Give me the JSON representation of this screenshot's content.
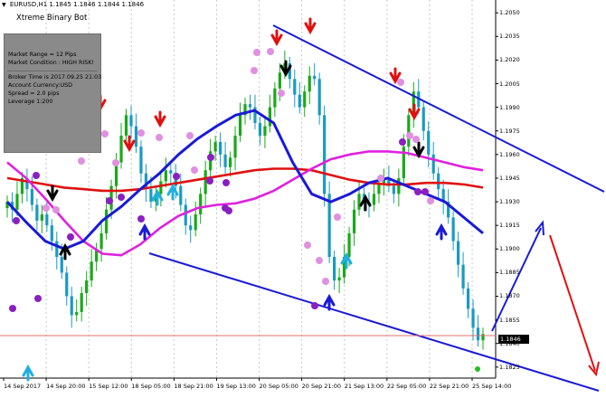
{
  "window": {
    "symbol_line": "EURUSD,H1  1.1845 1.1846 1.1844 1.1846",
    "indicator_title": "Xtreme Binary Bot"
  },
  "info_panel": {
    "market_range": "Market Range = 12 Pips",
    "market_condition": "Market Condition : HIGH RISK!",
    "broker_time": "Broker Time is 2017.09.25 21:03",
    "account_currency": "Account Currency:USD",
    "spread": "Spread = 2.0 pips",
    "leverage": "Leverage 1:200"
  },
  "current_price": "1.1846",
  "colors": {
    "background": "#ffffff",
    "bull_candle": "#1aa81a",
    "bear_candle": "#1a9ac0",
    "trend_channel": "#1a1ad8",
    "ma_red": "#e01010",
    "ma_magenta": "#e020e0",
    "arrow_red": "#e01010",
    "arrow_black": "#000000",
    "arrow_cyan": "#20b0e0",
    "dot_purple": "#8a20c0",
    "dot_pink": "#e090e0",
    "price_line": "#e07070"
  },
  "chart_data": {
    "type": "candlestick",
    "symbol": "EURUSD",
    "timeframe": "H1",
    "ylim": [
      1.1818,
      1.2057
    ],
    "y_ticks": [
      "1.2050",
      "1.2035",
      "1.2020",
      "1.2005",
      "1.1990",
      "1.1975",
      "1.1960",
      "1.1945",
      "1.1930",
      "1.1915",
      "1.1900",
      "1.1885",
      "1.1870",
      "1.1855",
      "1.1840",
      "1.1825"
    ],
    "x_ticks": [
      "14 Sep 2017",
      "14 Sep 20:00",
      "15 Sep 12:00",
      "18 Sep 05:00",
      "18 Sep 21:00",
      "19 Sep 13:00",
      "20 Sep 05:00",
      "20 Sep 21:00",
      "21 Sep 13:00",
      "22 Sep 05:00",
      "22 Sep 21:00",
      "25 Sep 14:00"
    ],
    "close": [
      1.193,
      1.1925,
      1.1935,
      1.1945,
      1.1938,
      1.1928,
      1.1918,
      1.1922,
      1.1915,
      1.1905,
      1.1895,
      1.1885,
      1.187,
      1.1858,
      1.186,
      1.1872,
      1.188,
      1.1892,
      1.19,
      1.191,
      1.1925,
      1.194,
      1.1955,
      1.1972,
      1.1985,
      1.1978,
      1.1965,
      1.1948,
      1.1938,
      1.193,
      1.1935,
      1.1943,
      1.195,
      1.1948,
      1.194,
      1.1928,
      1.1915,
      1.1912,
      1.1922,
      1.1935,
      1.195,
      1.1962,
      1.1968,
      1.196,
      1.1952,
      1.1958,
      1.1972,
      1.1985,
      1.1992,
      1.199,
      1.198,
      1.1972,
      1.1978,
      1.199,
      1.2002,
      1.2012,
      1.2018,
      1.2008,
      1.1998,
      1.199,
      1.2,
      1.201,
      1.2008,
      1.1985,
      1.1935,
      1.1895,
      1.188,
      1.1882,
      1.1895,
      1.191,
      1.1925,
      1.1935,
      1.193,
      1.1928,
      1.1935,
      1.1942,
      1.1945,
      1.194,
      1.1935,
      1.1945,
      1.1965,
      1.1985,
      1.2,
      1.199,
      1.1975,
      1.196,
      1.1948,
      1.1938,
      1.193,
      1.192,
      1.1905,
      1.189,
      1.1875,
      1.1862,
      1.185,
      1.1842,
      1.1846
    ],
    "moving_averages": [
      {
        "color": "red",
        "values": [
          1.1945,
          1.1943,
          1.1941,
          1.1939,
          1.1938,
          1.1937,
          1.1937,
          1.1938,
          1.194,
          1.1942,
          1.1944,
          1.1946,
          1.1948,
          1.195,
          1.1951,
          1.1951,
          1.195,
          1.1947,
          1.1944,
          1.1942,
          1.1941,
          1.1941,
          1.1942,
          1.1942,
          1.1941,
          1.1939
        ]
      },
      {
        "color": "magenta",
        "values": [
          1.1955,
          1.1945,
          1.1932,
          1.1918,
          1.1905,
          1.1897,
          1.1896,
          1.1903,
          1.1913,
          1.1921,
          1.1926,
          1.1928,
          1.1929,
          1.1932,
          1.1937,
          1.1944,
          1.1951,
          1.1957,
          1.196,
          1.1962,
          1.1962,
          1.1961,
          1.1958,
          1.1955,
          1.1952,
          1.195
        ]
      },
      {
        "color": "blue",
        "values": [
          1.193,
          1.1917,
          1.1905,
          1.19,
          1.1905,
          1.1918,
          1.1927,
          1.1938,
          1.1948,
          1.196,
          1.197,
          1.1978,
          1.1985,
          1.1988,
          1.198,
          1.1955,
          1.1935,
          1.193,
          1.1935,
          1.1942,
          1.1945,
          1.194,
          1.1935,
          1.193,
          1.192,
          1.191
        ]
      }
    ]
  }
}
